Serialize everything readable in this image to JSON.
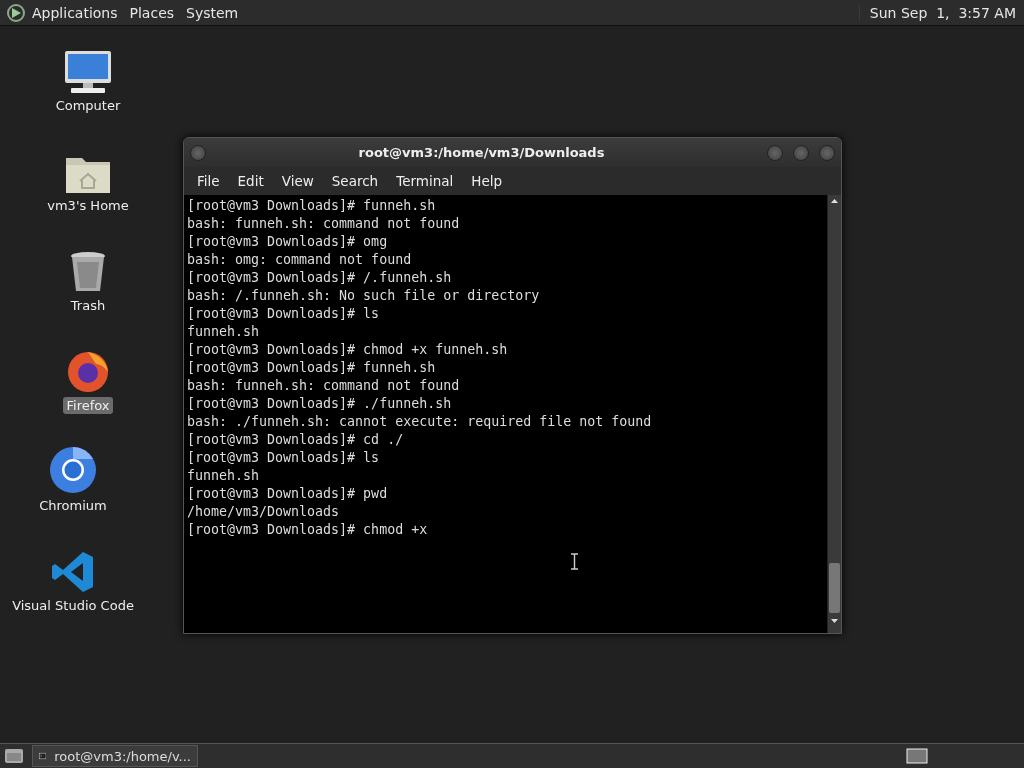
{
  "top_panel": {
    "menus": [
      "Applications",
      "Places",
      "System"
    ],
    "clock": "Sun Sep  1,  3:57 AM"
  },
  "desktop_icons": [
    {
      "kind": "computer",
      "label": "Computer",
      "selected": false
    },
    {
      "kind": "home",
      "label": "vm3's Home",
      "selected": false
    },
    {
      "kind": "trash",
      "label": "Trash",
      "selected": false
    },
    {
      "kind": "firefox",
      "label": "Firefox",
      "selected": true
    },
    {
      "kind": "chromium",
      "label": "Chromium",
      "selected": false
    },
    {
      "kind": "vscode",
      "label": "Visual Studio Code",
      "selected": false
    }
  ],
  "terminal_window": {
    "title": "root@vm3:/home/vm3/Downloads",
    "menus": [
      "File",
      "Edit",
      "View",
      "Search",
      "Terminal",
      "Help"
    ],
    "lines": [
      "[root@vm3 Downloads]# funneh.sh",
      "bash: funneh.sh: command not found",
      "[root@vm3 Downloads]# omg",
      "bash: omg: command not found",
      "[root@vm3 Downloads]# /.funneh.sh",
      "bash: /.funneh.sh: No such file or directory",
      "[root@vm3 Downloads]# ls",
      "funneh.sh",
      "[root@vm3 Downloads]# chmod +x funneh.sh",
      "[root@vm3 Downloads]# funneh.sh",
      "bash: funneh.sh: command not found",
      "[root@vm3 Downloads]# ./funneh.sh",
      "bash: ./funneh.sh: cannot execute: required file not found",
      "[root@vm3 Downloads]# cd ./",
      "[root@vm3 Downloads]# ls",
      "funneh.sh",
      "[root@vm3 Downloads]# pwd",
      "/home/vm3/Downloads",
      "[root@vm3 Downloads]# chmod +x"
    ]
  },
  "bottom_panel": {
    "tasks": [
      {
        "label": "root@vm3:/home/v...",
        "selected": false
      }
    ]
  }
}
